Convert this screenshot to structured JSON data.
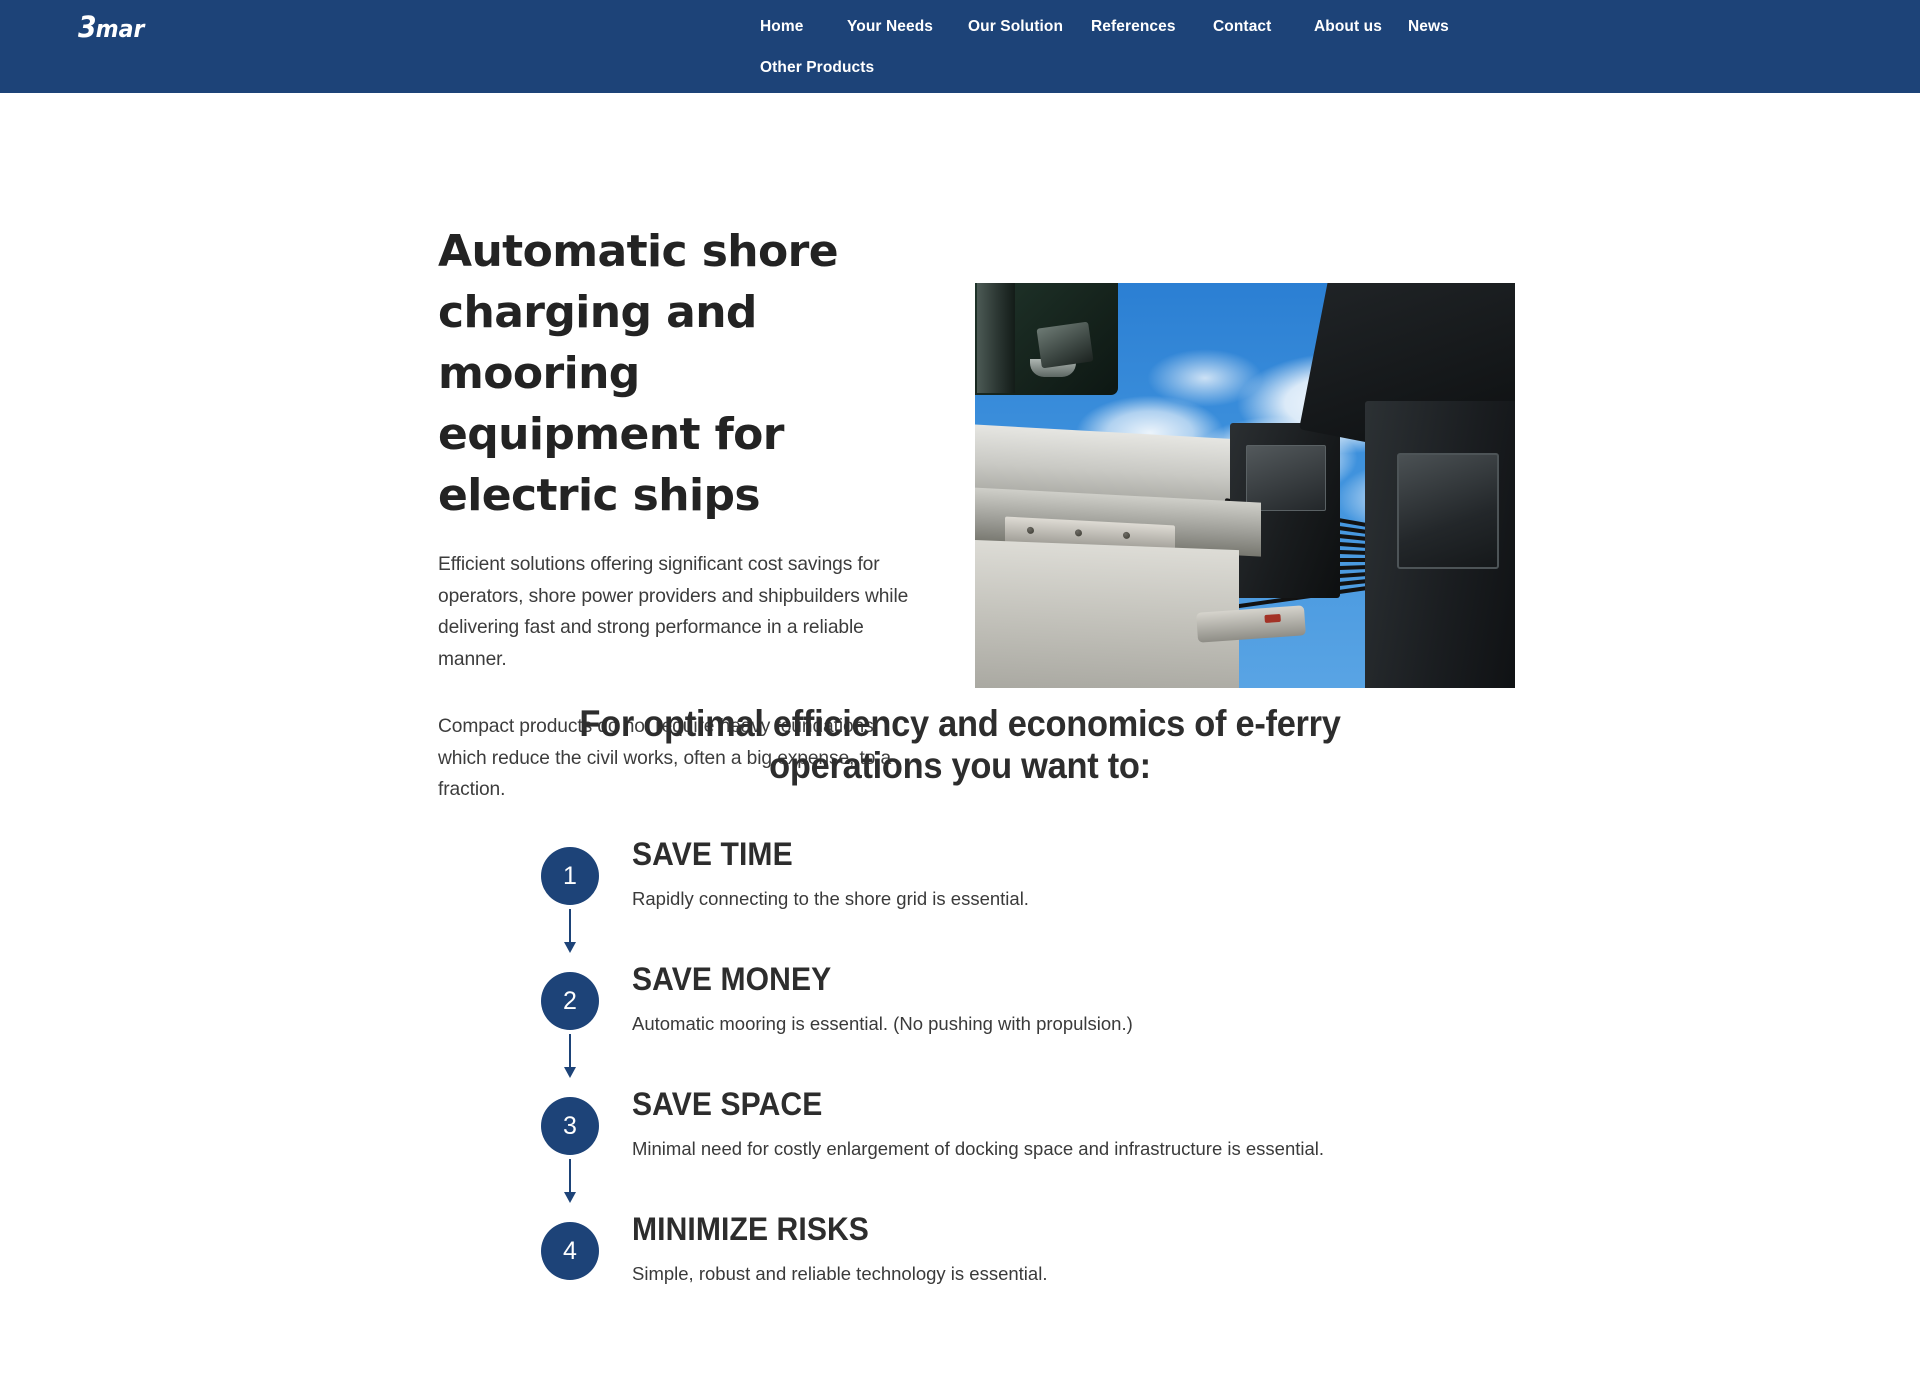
{
  "header": {
    "logo": {
      "part1": "3",
      "part2": "mar"
    },
    "nav_row1": [
      {
        "label": "Home"
      },
      {
        "label": "Your Needs"
      },
      {
        "label": "Our Solution"
      },
      {
        "label": "References"
      },
      {
        "label": "Contact"
      },
      {
        "label": "About us"
      },
      {
        "label": "News"
      }
    ],
    "nav_row2": [
      {
        "label": "Other Products"
      }
    ],
    "background_color": "#1d4378"
  },
  "hero": {
    "title": "Automatic shore charging and mooring equipment for electric ships",
    "paragraph1": "Efficient solutions offering significant cost savings for operators, shore power providers and shipbuilders while delivering fast and strong performance in a reliable manner.",
    "paragraph2": "Compact products do not require heavy foundations which reduce the civil works, often a big expense, to a fraction.",
    "photo_alt": "Automatic shore charging connector arm with cable bundle against blue sky"
  },
  "section2": {
    "title": "For optimal efficiency and economics of e-ferry operations you want to:",
    "accent_color": "#1d4378",
    "steps": [
      {
        "number": "1",
        "heading": "SAVE TIME",
        "description": "Rapidly connecting to the shore grid is essential."
      },
      {
        "number": "2",
        "heading": "SAVE MONEY",
        "description": "Automatic mooring is essential. (No pushing with propulsion.)"
      },
      {
        "number": "3",
        "heading": "SAVE SPACE",
        "description": "Minimal need for costly enlargement of docking space and infrastructure is essential."
      },
      {
        "number": "4",
        "heading": "MINIMIZE RISKS",
        "description": "Simple, robust and reliable technology is essential."
      }
    ]
  }
}
